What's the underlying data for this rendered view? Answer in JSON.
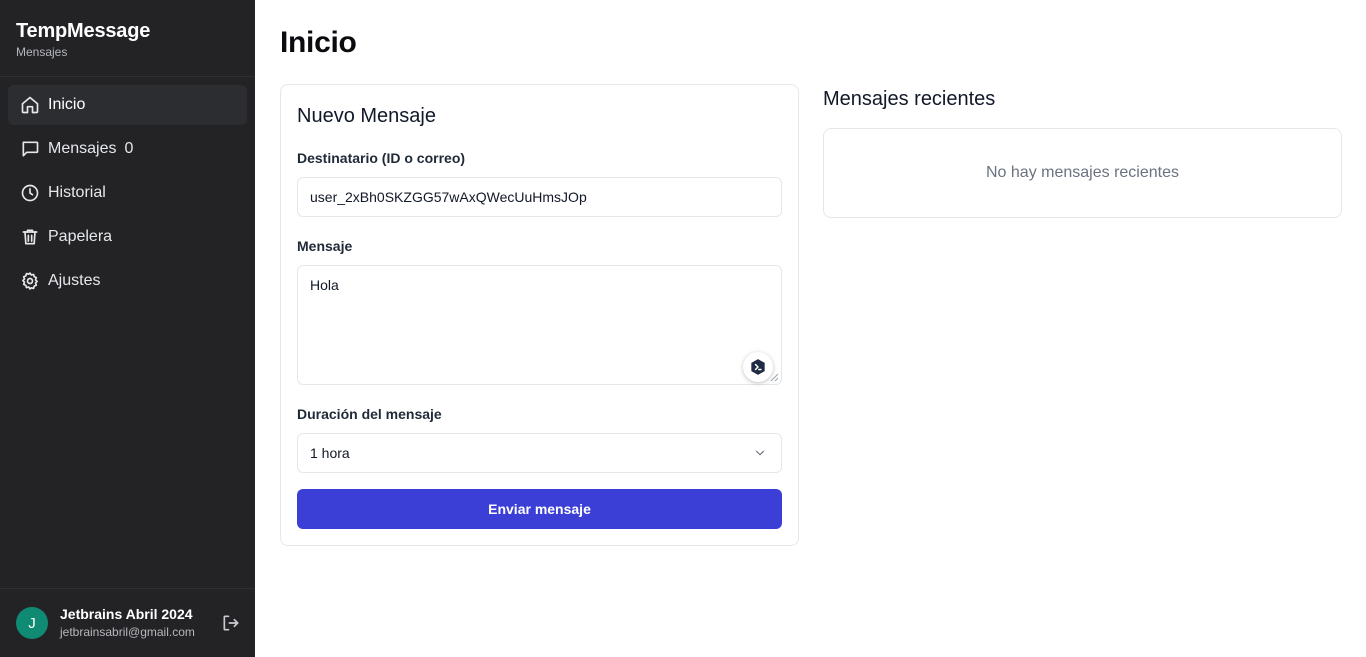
{
  "brand": {
    "title": "TempMessage",
    "subtitle": "Mensajes"
  },
  "nav": [
    {
      "label": "Inicio",
      "icon": "home-icon",
      "active": true
    },
    {
      "label": "Mensajes",
      "icon": "message-square-icon",
      "count": "0"
    },
    {
      "label": "Historial",
      "icon": "clock-icon"
    },
    {
      "label": "Papelera",
      "icon": "trash-icon"
    },
    {
      "label": "Ajustes",
      "icon": "gear-icon"
    }
  ],
  "user": {
    "initial": "J",
    "name": "Jetbrains Abril 2024",
    "email": "jetbrainsabril@gmail.com"
  },
  "page": {
    "title": "Inicio"
  },
  "new_message": {
    "title": "Nuevo Mensaje",
    "recipient_label": "Destinatario (ID o correo)",
    "recipient_value": "user_2xBh0SKZGG57wAxQWecUuHmsJOp",
    "message_label": "Mensaje",
    "message_value": "Hola",
    "duration_label": "Duración del mensaje",
    "duration_value": "1 hora",
    "submit_label": "Enviar mensaje"
  },
  "recent": {
    "title": "Mensajes recientes",
    "empty_text": "No hay mensajes recientes"
  },
  "colors": {
    "sidebar_bg": "#232326",
    "accent": "#3b3fd6",
    "avatar_bg": "#0f8a73"
  }
}
